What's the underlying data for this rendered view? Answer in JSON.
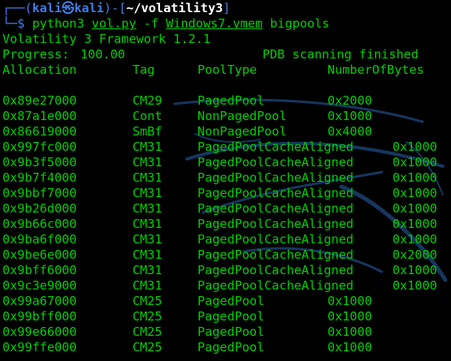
{
  "colors": {
    "background": "#000000",
    "text_green": "#00d000",
    "prompt_blue": "#3f7de8",
    "path_white": "#ffffff"
  },
  "prompt": {
    "frame_top": "┌──(",
    "user": "kali",
    "at_icon": "㉿",
    "host": "kali",
    "separator": ")-[",
    "cwd": "~/volatility3",
    "frame_end": "]",
    "frame_bottom": "└─$"
  },
  "command": {
    "program": "python3",
    "script": "vol.py",
    "flag": "-f",
    "file": "Windows7.vmem",
    "plugin": "bigpools"
  },
  "output": {
    "banner": "Volatility 3 Framework 1.2.1",
    "progress_label": "Progress:",
    "progress_value": "100.00",
    "progress_status": "PDB scanning finished",
    "headers": [
      "Allocation",
      "Tag",
      "PoolType",
      "NumberOfBytes"
    ],
    "rows": [
      {
        "allocation": "0x89e27000",
        "tag": "CM29",
        "pool_type": "PagedPool",
        "bytes": "0x2000"
      },
      {
        "allocation": "0x87a1e000",
        "tag": "Cont",
        "pool_type": "NonPagedPool",
        "bytes": "0x1000"
      },
      {
        "allocation": "0x86619000",
        "tag": "SmBf",
        "pool_type": "NonPagedPool",
        "bytes": "0x4000"
      },
      {
        "allocation": "0x997fc000",
        "tag": "CM31",
        "pool_type": "PagedPoolCacheAligned",
        "bytes": "0x1000"
      },
      {
        "allocation": "0x9b3f5000",
        "tag": "CM31",
        "pool_type": "PagedPoolCacheAligned",
        "bytes": "0x1000"
      },
      {
        "allocation": "0x9b7f4000",
        "tag": "CM31",
        "pool_type": "PagedPoolCacheAligned",
        "bytes": "0x1000"
      },
      {
        "allocation": "0x9bbf7000",
        "tag": "CM31",
        "pool_type": "PagedPoolCacheAligned",
        "bytes": "0x1000"
      },
      {
        "allocation": "0x9b26d000",
        "tag": "CM31",
        "pool_type": "PagedPoolCacheAligned",
        "bytes": "0x1000"
      },
      {
        "allocation": "0x9b66c000",
        "tag": "CM31",
        "pool_type": "PagedPoolCacheAligned",
        "bytes": "0x1000"
      },
      {
        "allocation": "0x9ba6f000",
        "tag": "CM31",
        "pool_type": "PagedPoolCacheAligned",
        "bytes": "0x1000"
      },
      {
        "allocation": "0x9be6e000",
        "tag": "CM31",
        "pool_type": "PagedPoolCacheAligned",
        "bytes": "0x2000"
      },
      {
        "allocation": "0x9bff6000",
        "tag": "CM31",
        "pool_type": "PagedPoolCacheAligned",
        "bytes": "0x1000"
      },
      {
        "allocation": "0x9c3e9000",
        "tag": "CM31",
        "pool_type": "PagedPoolCacheAligned",
        "bytes": "0x1000"
      },
      {
        "allocation": "0x99a67000",
        "tag": "CM25",
        "pool_type": "PagedPool",
        "bytes": "0x1000"
      },
      {
        "allocation": "0x99bff000",
        "tag": "CM25",
        "pool_type": "PagedPool",
        "bytes": "0x1000"
      },
      {
        "allocation": "0x99e66000",
        "tag": "CM25",
        "pool_type": "PagedPool",
        "bytes": "0x1000"
      },
      {
        "allocation": "0x99ffe000",
        "tag": "CM25",
        "pool_type": "PagedPool",
        "bytes": "0x1000"
      }
    ]
  }
}
